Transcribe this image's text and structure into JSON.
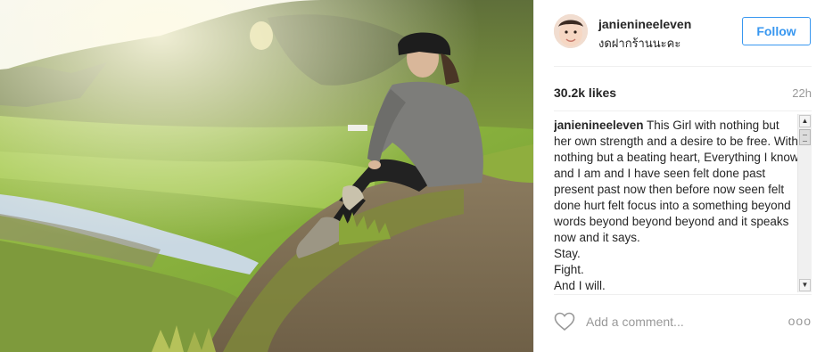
{
  "post": {
    "username": "janienineeleven",
    "location": "งดฝากร้านนะคะ",
    "follow_label": "Follow",
    "likes": "30.2k likes",
    "time": "22h",
    "caption_user": "janienineeleven",
    "caption_text": " This Girl with nothing but her own strength and a desire to be free. With nothing but a beating heart, Everything I know and I am and I have seen felt done past present past now then before now seen felt done hurt felt focus into a something beyond words beyond beyond beyond and it speaks now and it says.\nStay.\nFight.\nAnd I will.",
    "comment_placeholder": "Add a comment...",
    "more_icon": "more-dots-icon",
    "heart_icon": "heart-outline-icon"
  },
  "colors": {
    "accent": "#3897f0",
    "text": "#262626",
    "muted": "#999999"
  }
}
